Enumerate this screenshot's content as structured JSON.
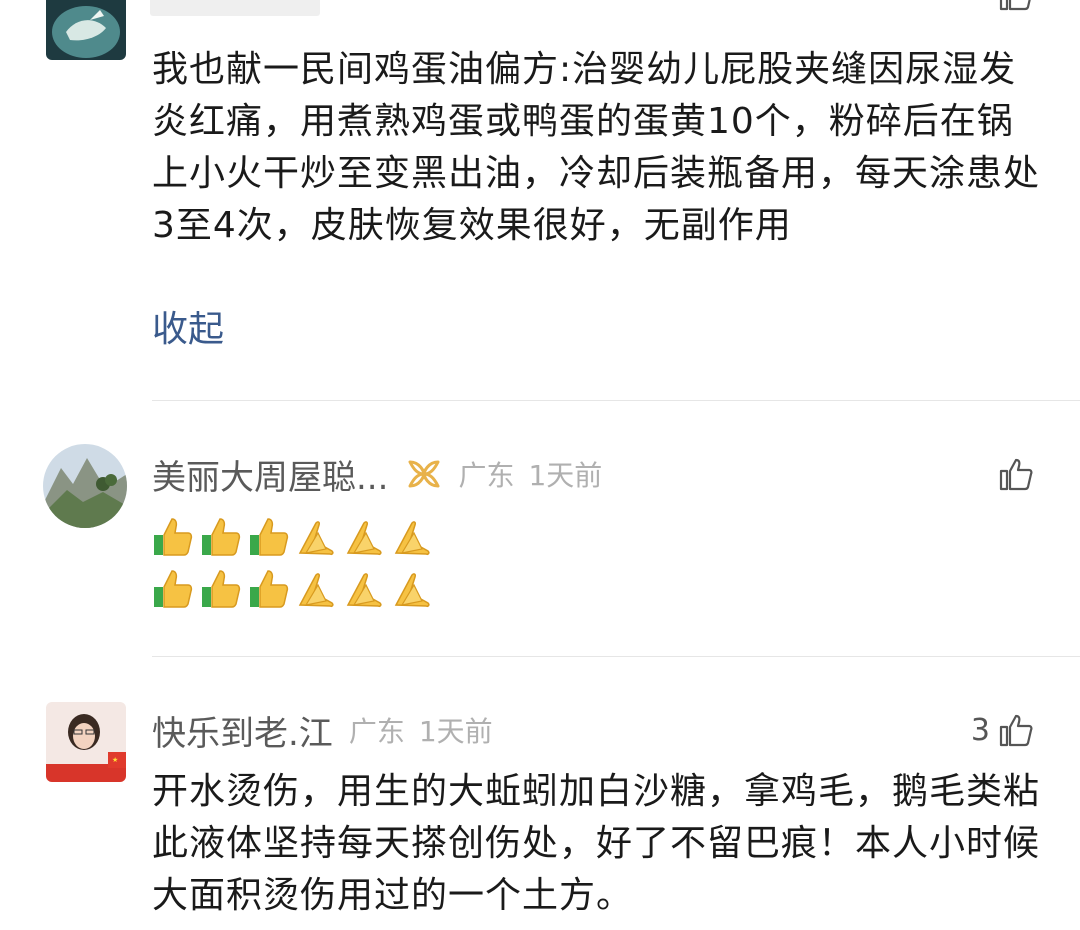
{
  "comments": [
    {
      "body": "我也献一民间鸡蛋油偏方:治婴幼儿屁股夹缝因尿湿发炎红痛，用煮熟鸡蛋或鸭蛋的蛋黄10个，粉碎后在锅上小火干炒至变黑出油，冷却后装瓶备用，每天涂患处3至4次，皮肤恢复效果很好，无副作用",
      "collapse_label": "收起",
      "avatar_icon": "horse-avatar-icon",
      "like_icon": "thumbs-up-icon"
    },
    {
      "username": "美丽大周屋聪...",
      "badge_icon": "ribbon-badge-icon",
      "location": "广东",
      "time": "1天前",
      "avatar_icon": "mountain-landscape-avatar-icon",
      "like_icon": "thumbs-up-icon",
      "emoji_rows": [
        [
          "thumbs-up",
          "thumbs-up",
          "thumbs-up",
          "pray",
          "pray",
          "pray"
        ],
        [
          "thumbs-up",
          "thumbs-up",
          "thumbs-up",
          "pray",
          "pray",
          "pray"
        ]
      ]
    },
    {
      "username": "快乐到老.江",
      "location": "广东",
      "time": "1天前",
      "like_count": "3",
      "avatar_icon": "woman-portrait-avatar-icon",
      "like_icon": "thumbs-up-icon",
      "body": "开水烫伤，用生的大蚯蚓加白沙糖，拿鸡毛，鹅毛类粘此液体坚持每天搽创伤处，好了不留巴痕！本人小时候大面积烫伤用过的一个土方。"
    }
  ],
  "colors": {
    "link": "#3a5a8c",
    "username": "#5a5a5a",
    "meta_gray": "#b0b0b0",
    "badge_gold": "#e8b24a"
  }
}
